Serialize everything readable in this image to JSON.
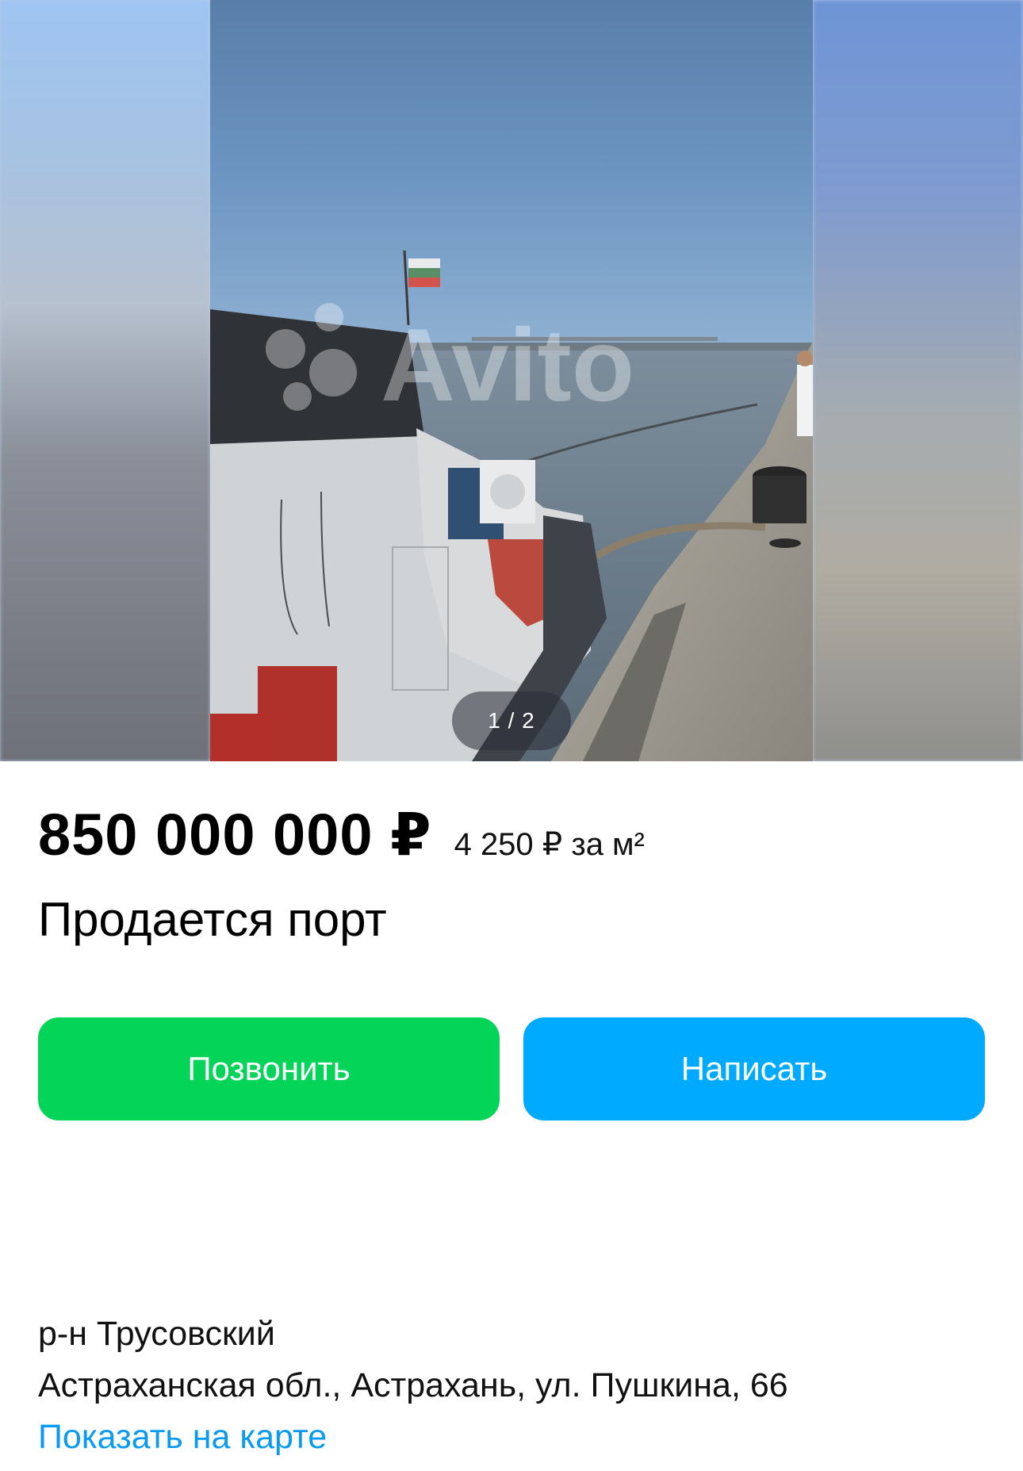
{
  "gallery": {
    "counter": "1 / 2",
    "watermark": "Avito"
  },
  "listing": {
    "price": "850 000 000 ₽",
    "price_per_sqm": "4 250 ₽ за м²",
    "title": "Продается порт"
  },
  "actions": {
    "call_label": "Позвонить",
    "write_label": "Написать"
  },
  "location": {
    "district": "р-н Трусовский",
    "address": "Астраханская обл., Астрахань, ул. Пушкина, 66",
    "map_link": "Показать на карте"
  },
  "colors": {
    "call_button": "#04d458",
    "write_button": "#00aaff",
    "link": "#0a9bf0"
  }
}
